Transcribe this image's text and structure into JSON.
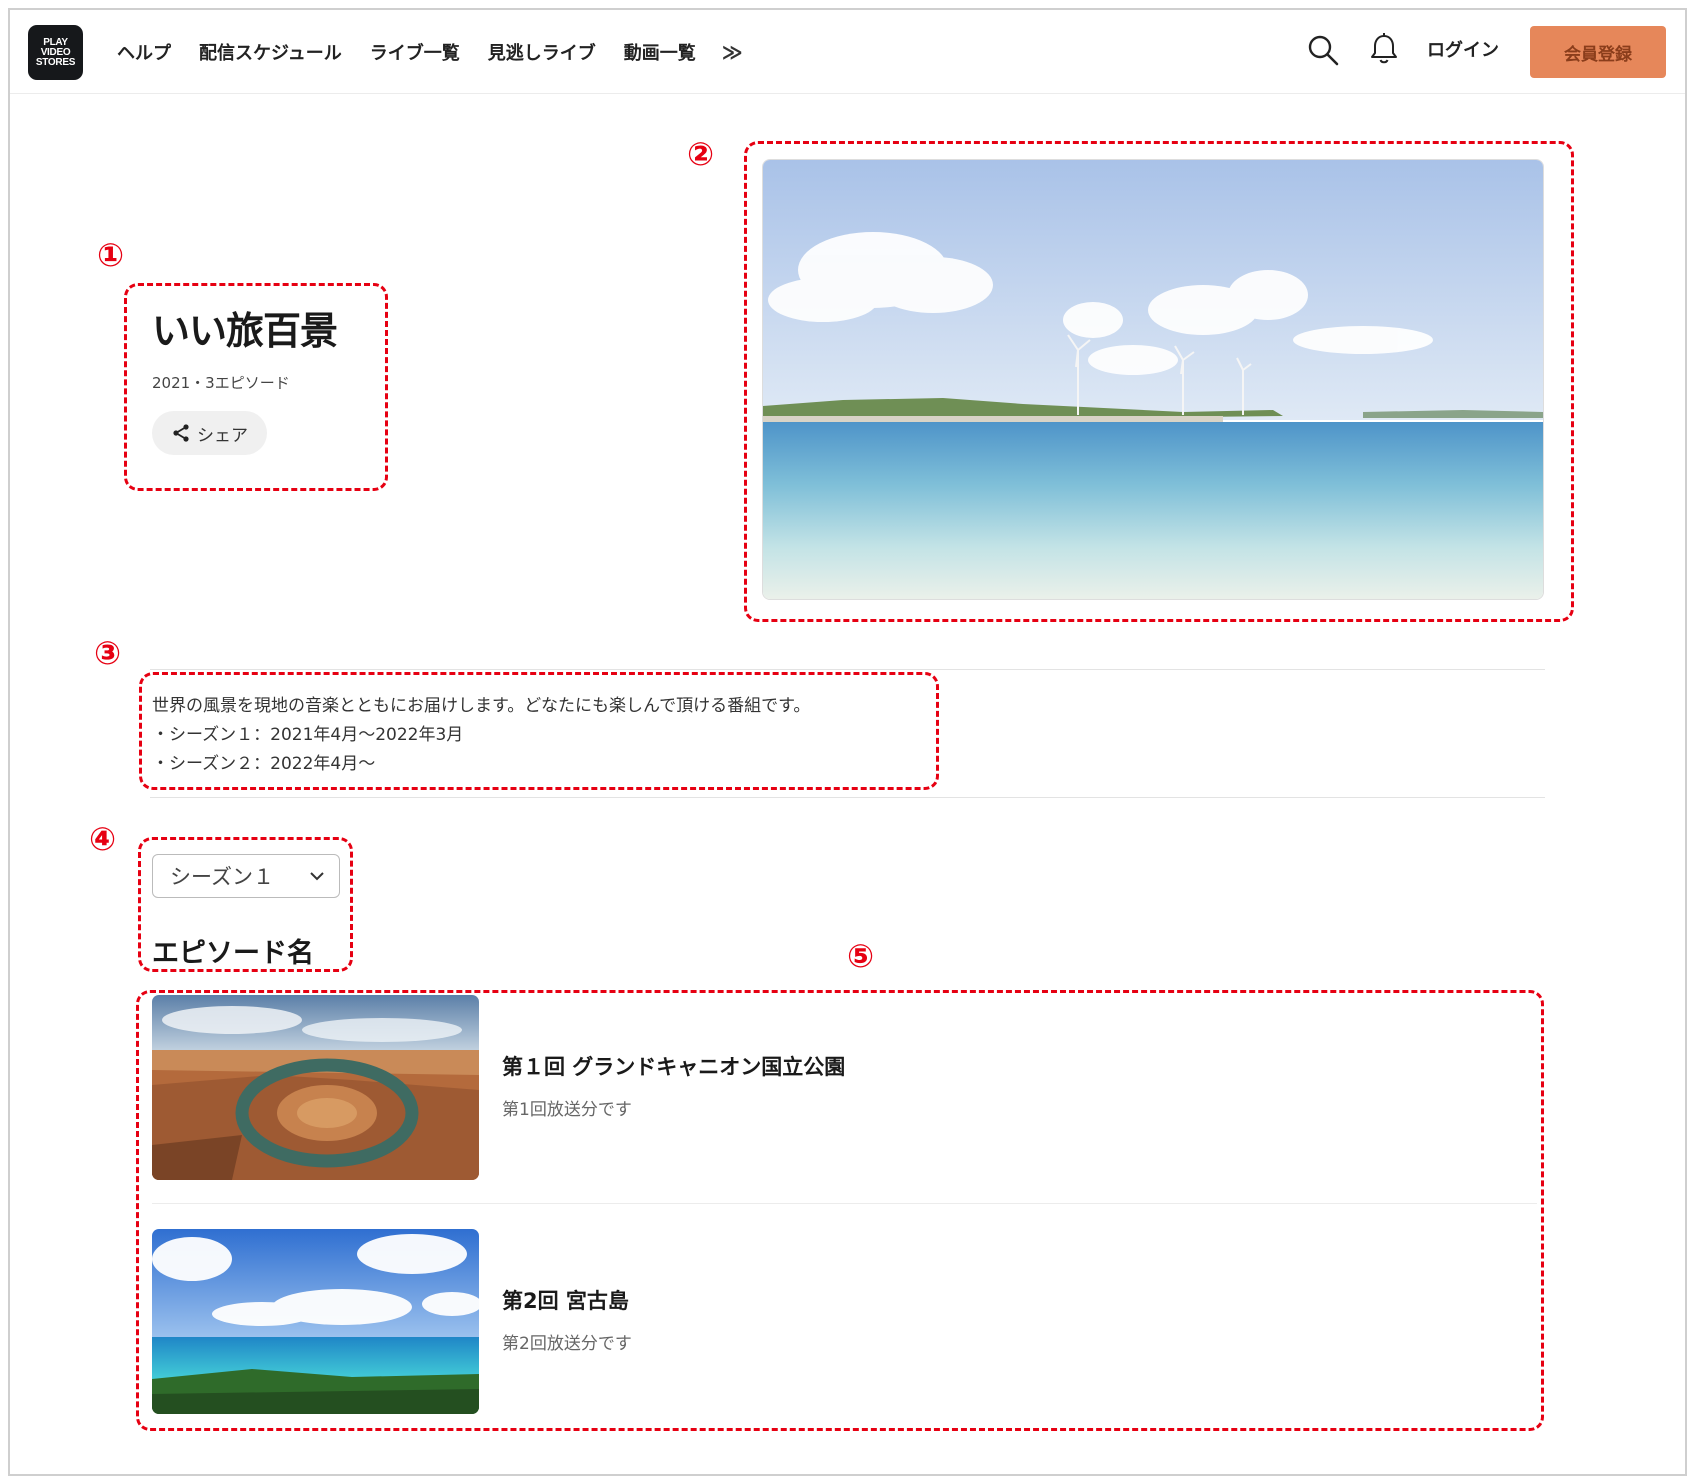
{
  "header": {
    "logo_lines": [
      "PLAY",
      "VIDEO",
      "STORES"
    ],
    "nav": [
      "ヘルプ",
      "配信スケジュール",
      "ライブ一覧",
      "見逃しライブ",
      "動画一覧"
    ],
    "nav_more": "≫",
    "login": "ログイン",
    "signup": "会員登録",
    "icons": [
      "search-icon",
      "bell-icon"
    ]
  },
  "annotations": [
    "①",
    "②",
    "③",
    "④",
    "⑤"
  ],
  "program": {
    "title": "いい旅百景",
    "meta": "2021・3エピソード",
    "share": "シェア"
  },
  "description": {
    "line1": "世界の風景を現地の音楽とともにお届けします。どなたにも楽しんで頂ける番組です。",
    "line2": "・シーズン１：2021年4月〜2022年3月",
    "line3": "・シーズン２：2022年4月〜"
  },
  "season_select": {
    "value": "シーズン１"
  },
  "episodes_heading": "エピソード名",
  "episodes": [
    {
      "title": "第１回 グランドキャニオン国立公園",
      "subtitle": "第1回放送分です"
    },
    {
      "title": "第2回 宮古島",
      "subtitle": "第2回放送分です"
    }
  ],
  "colors": {
    "accent": "#e6875a",
    "annotation": "#e60012"
  }
}
